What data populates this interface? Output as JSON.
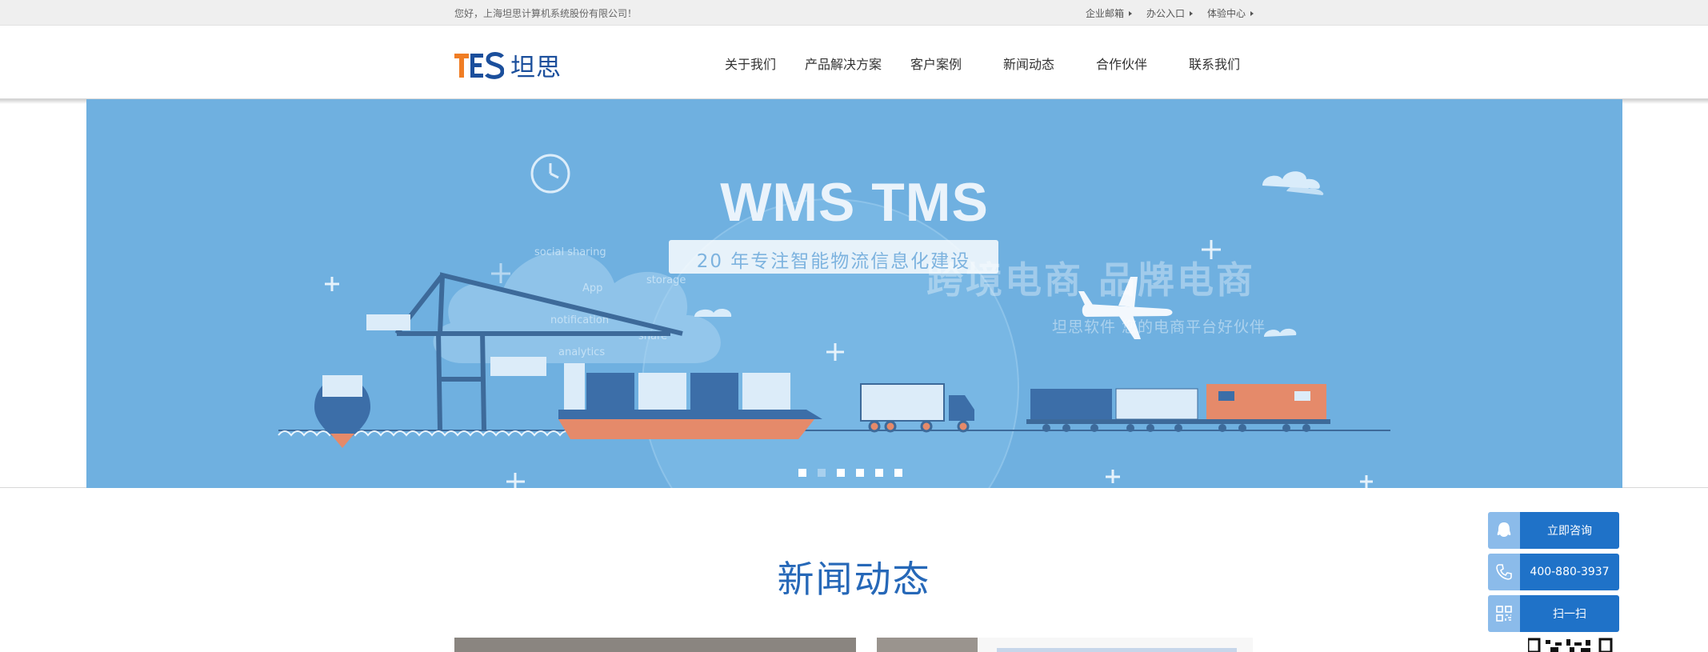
{
  "topbar": {
    "greeting": "您好，上海坦思计算机系统股份有限公司！",
    "links": [
      {
        "label": "企业邮箱"
      },
      {
        "label": "办公入口"
      },
      {
        "label": "体验中心"
      }
    ]
  },
  "header": {
    "logo_text": "坦思",
    "nav": [
      {
        "label": "关于我们"
      },
      {
        "label": "产品解决方案"
      },
      {
        "label": "客户案例"
      },
      {
        "label": "新闻动态"
      },
      {
        "label": "合作伙伴"
      },
      {
        "label": "联系我们"
      }
    ]
  },
  "banner": {
    "title": "WMS TMS",
    "subtitle": "20 年专注智能物流信息化建设",
    "ghost_heading": "跨境电商  品牌电商",
    "ghost_sub": "坦思软件  您的电商平台好伙伴",
    "slide_count": 6,
    "active_slide": 2
  },
  "news": {
    "title": "新闻动态"
  },
  "float_widget": {
    "consult_label": "立即咨询",
    "phone_label": "400-880-3937",
    "scan_label": "扫一扫"
  },
  "colors": {
    "brand_blue": "#1f72c8",
    "logo_orange": "#f07d24",
    "banner_bg": "#6fb0e0"
  }
}
